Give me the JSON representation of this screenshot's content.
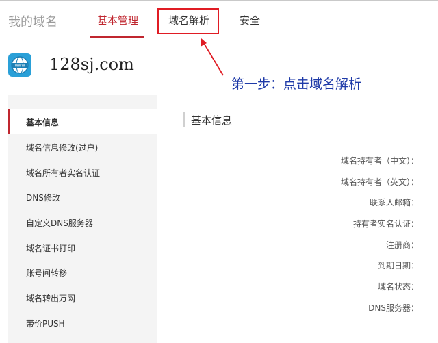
{
  "header": {
    "brand": "我的域名",
    "tabs": [
      "基本管理",
      "域名解析",
      "安全"
    ]
  },
  "domain": {
    "name": "128sj.com",
    "icon_text": "www"
  },
  "annotation": {
    "text": "第一步：点击域名解析"
  },
  "sidebar": {
    "items": [
      "基本信息",
      "域名信息修改(过户)",
      "域名所有者实名认证",
      "DNS修改",
      "自定义DNS服务器",
      "域名证书打印",
      "账号间转移",
      "域名转出万网",
      "带价PUSH"
    ]
  },
  "content": {
    "title": "基本信息",
    "fields": [
      "域名持有者（中文）：",
      "域名持有者（英文）：",
      "联系人邮箱：",
      "持有者实名认证：",
      "注册商：",
      "到期日期：",
      "域名状态：",
      "DNS服务器："
    ]
  },
  "colors": {
    "accent": "#c0262f",
    "highlight": "#e01c24",
    "annotation": "#1e3aa8",
    "sidebar_bg": "#f4f4f4"
  }
}
